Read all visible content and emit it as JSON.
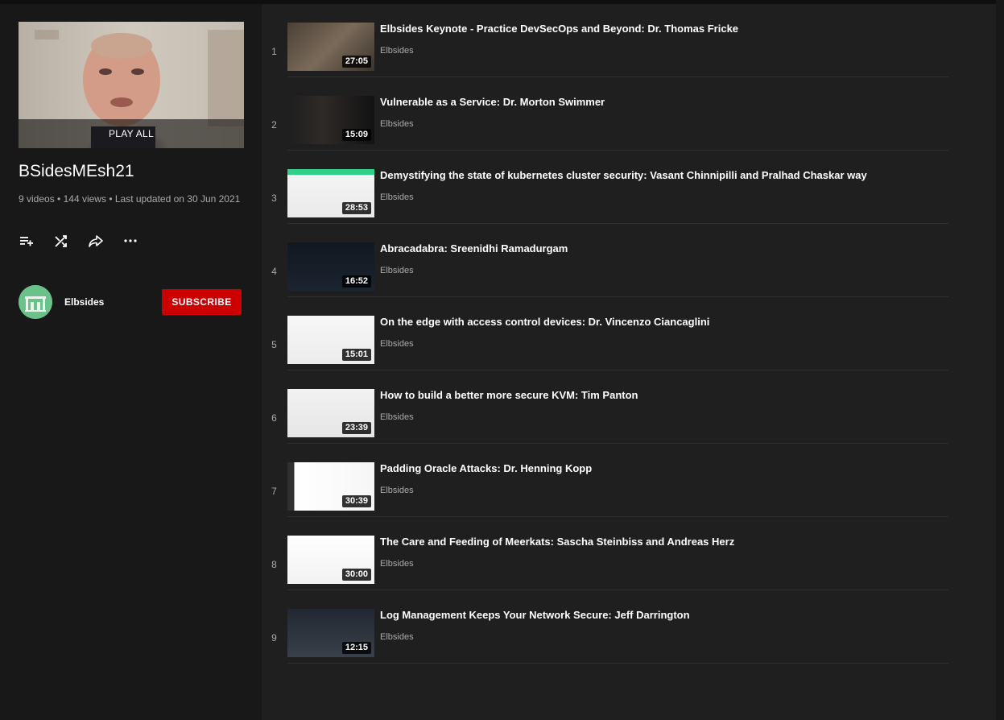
{
  "playlist": {
    "hero_label": "PLAY ALL",
    "title": "BSidesMEsh21",
    "video_count": "9 videos",
    "views": "144 views",
    "updated": "Last updated on 30 Jun 2021",
    "separator": "•",
    "actions": [
      "save-to-playlist-icon",
      "shuffle-icon",
      "share-icon",
      "more-icon"
    ]
  },
  "channel": {
    "name": "Elbsides",
    "subscribe_label": "SUBSCRIBE",
    "avatar_color": "#6ac28a"
  },
  "colors": {
    "subscribe": "#cc0000",
    "background": "#1f1f1f",
    "sidebar": "#181818"
  },
  "videos": [
    {
      "index": "1",
      "title": "Elbsides Keynote - Practice DevSecOps and Beyond: Dr. Thomas Fricke",
      "channel": "Elbsides",
      "duration": "27:05"
    },
    {
      "index": "2",
      "title": "Vulnerable as a Service: Dr. Morton Swimmer",
      "channel": "Elbsides",
      "duration": "15:09"
    },
    {
      "index": "3",
      "title": "Demystifying the state of kubernetes cluster security: Vasant Chinnipilli and Pralhad Chaskar way",
      "channel": "Elbsides",
      "duration": "28:53"
    },
    {
      "index": "4",
      "title": "Abracadabra: Sreenidhi Ramadurgam",
      "channel": "Elbsides",
      "duration": "16:52"
    },
    {
      "index": "5",
      "title": "On the edge with access control devices: Dr. Vincenzo Ciancaglini",
      "channel": "Elbsides",
      "duration": "15:01"
    },
    {
      "index": "6",
      "title": "How to build a better more secure KVM: Tim Panton",
      "channel": "Elbsides",
      "duration": "23:39"
    },
    {
      "index": "7",
      "title": "Padding Oracle Attacks: Dr. Henning Kopp",
      "channel": "Elbsides",
      "duration": "30:39"
    },
    {
      "index": "8",
      "title": "The Care and Feeding of Meerkats: Sascha Steinbiss and Andreas Herz",
      "channel": "Elbsides",
      "duration": "30:00"
    },
    {
      "index": "9",
      "title": "Log Management Keeps Your Network Secure: Jeff Darrington",
      "channel": "Elbsides",
      "duration": "12:15"
    }
  ]
}
